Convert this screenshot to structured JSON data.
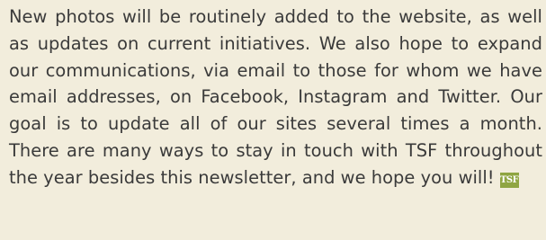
{
  "article": {
    "paragraph": "New photos will be routinely added to the website, as well as updates on current initiatives. We also hope to expand our communications, via email to those for whom we have email addresses, on Facebook, Instagram and Twitter. Our goal is to update all of our sites several times a month. There are many ways to stay in touch with TSF throughout the year besides this newsletter, and we hope you will!",
    "end_mark": "TSF"
  },
  "colors": {
    "background": "#f2eddc",
    "text": "#3a3a3a",
    "logo": "#8fa542"
  }
}
